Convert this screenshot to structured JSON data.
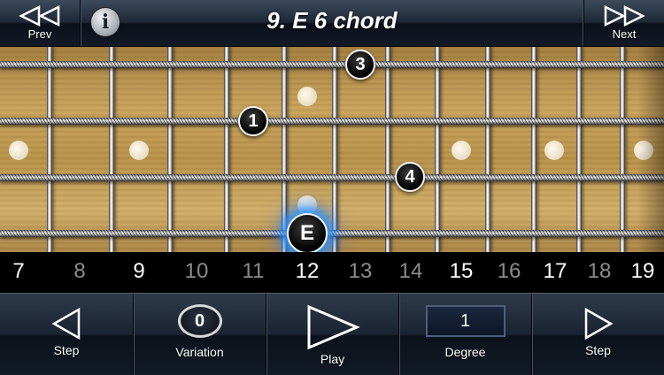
{
  "header": {
    "prev_label": "Prev",
    "next_label": "Next",
    "info_glyph": "i",
    "title": "9. E 6 chord"
  },
  "fretboard": {
    "notes": [
      {
        "label": "3",
        "role": "finger"
      },
      {
        "label": "1",
        "role": "finger"
      },
      {
        "label": "4",
        "role": "finger"
      },
      {
        "label": "E",
        "role": "root"
      }
    ],
    "fret_numbers": [
      {
        "n": "7",
        "dim": false
      },
      {
        "n": "8",
        "dim": true
      },
      {
        "n": "9",
        "dim": false
      },
      {
        "n": "10",
        "dim": true
      },
      {
        "n": "11",
        "dim": true
      },
      {
        "n": "12",
        "dim": false
      },
      {
        "n": "13",
        "dim": true
      },
      {
        "n": "14",
        "dim": true
      },
      {
        "n": "15",
        "dim": false
      },
      {
        "n": "16",
        "dim": true
      },
      {
        "n": "17",
        "dim": false
      },
      {
        "n": "18",
        "dim": true
      },
      {
        "n": "19",
        "dim": false
      }
    ]
  },
  "toolbar": {
    "step_back_label": "Step",
    "variation_label": "Variation",
    "variation_value": "0",
    "play_label": "Play",
    "degree_label": "Degree",
    "degree_value": "1",
    "step_forward_label": "Step"
  },
  "colors": {
    "root_glow": "#2a96ff",
    "wood": "#c9a45d",
    "dim_number": "#8b8b8b"
  }
}
